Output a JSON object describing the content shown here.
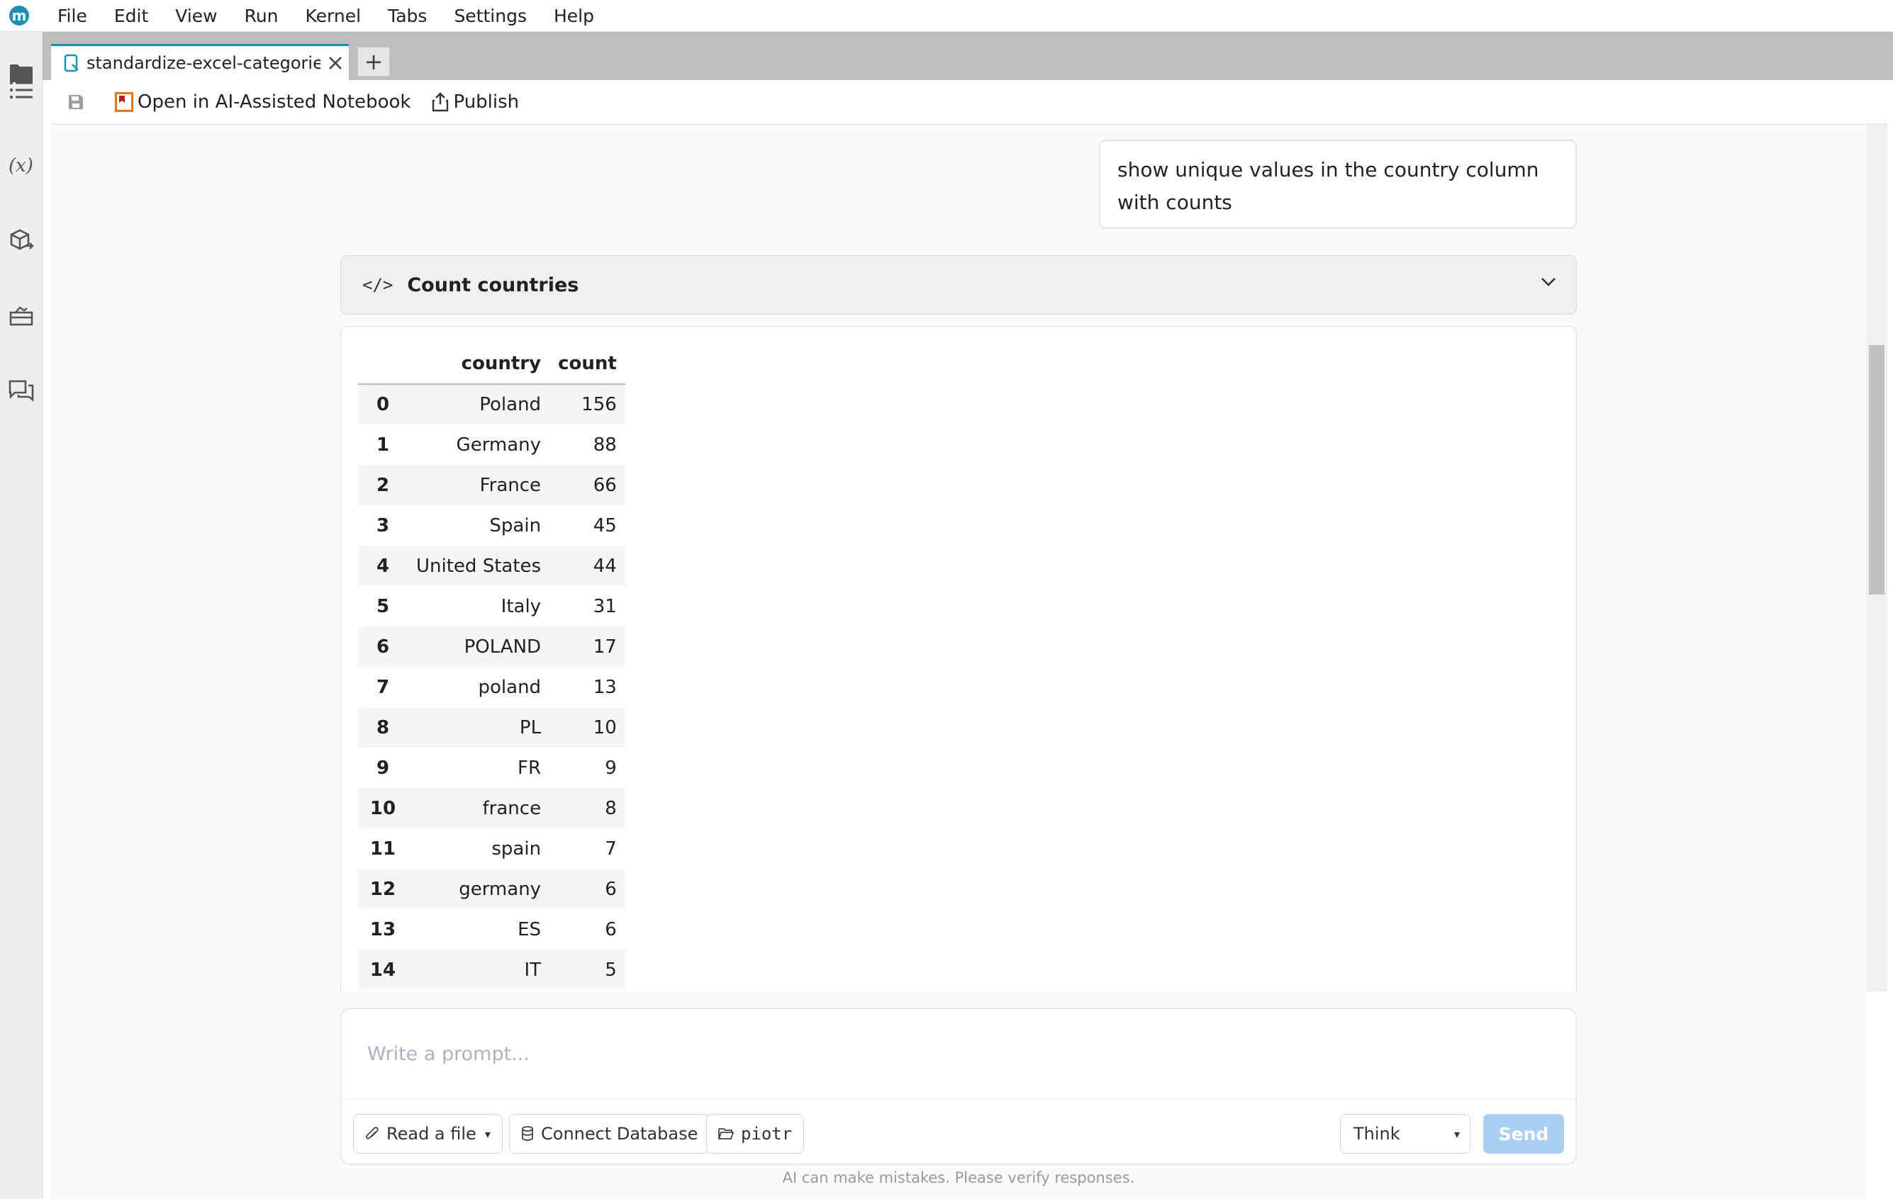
{
  "app": {
    "logo_letter": "m",
    "menu": [
      "File",
      "Edit",
      "View",
      "Run",
      "Kernel",
      "Tabs",
      "Settings",
      "Help"
    ]
  },
  "tab": {
    "title": "standardize-excel-categories.ipynb",
    "new_tab_symbol": "+"
  },
  "toolbar": {
    "open_ai_label": "Open in AI-Assisted Notebook",
    "publish_label": "Publish"
  },
  "chat": {
    "user_message": "show unique values in the country column with counts",
    "code_block": {
      "icon_text": "</>",
      "title": "Count countries"
    }
  },
  "table": {
    "columns": [
      "",
      "country",
      "count"
    ],
    "rows": [
      {
        "index": "0",
        "country": "Poland",
        "count": "156"
      },
      {
        "index": "1",
        "country": "Germany",
        "count": "88"
      },
      {
        "index": "2",
        "country": "France",
        "count": "66"
      },
      {
        "index": "3",
        "country": "Spain",
        "count": "45"
      },
      {
        "index": "4",
        "country": "United States",
        "count": "44"
      },
      {
        "index": "5",
        "country": "Italy",
        "count": "31"
      },
      {
        "index": "6",
        "country": "POLAND",
        "count": "17"
      },
      {
        "index": "7",
        "country": "poland",
        "count": "13"
      },
      {
        "index": "8",
        "country": "PL",
        "count": "10"
      },
      {
        "index": "9",
        "country": "FR",
        "count": "9"
      },
      {
        "index": "10",
        "country": "france",
        "count": "8"
      },
      {
        "index": "11",
        "country": "spain",
        "count": "7"
      },
      {
        "index": "12",
        "country": "germany",
        "count": "6"
      },
      {
        "index": "13",
        "country": "ES",
        "count": "6"
      },
      {
        "index": "14",
        "country": "IT",
        "count": "5"
      }
    ]
  },
  "prompt": {
    "placeholder": "Write a prompt...",
    "read_file_label": "Read a file",
    "connect_db_label": "Connect Database",
    "user_dir_label": "piotr",
    "mode_value": "Think",
    "send_label": "Send",
    "disclaimer": "AI can make mistakes. Please verify responses."
  },
  "colors": {
    "accent": "#1a8fb6",
    "send_disabled": "#a9cff3",
    "ai_notebook_icon": "#e8751a"
  }
}
